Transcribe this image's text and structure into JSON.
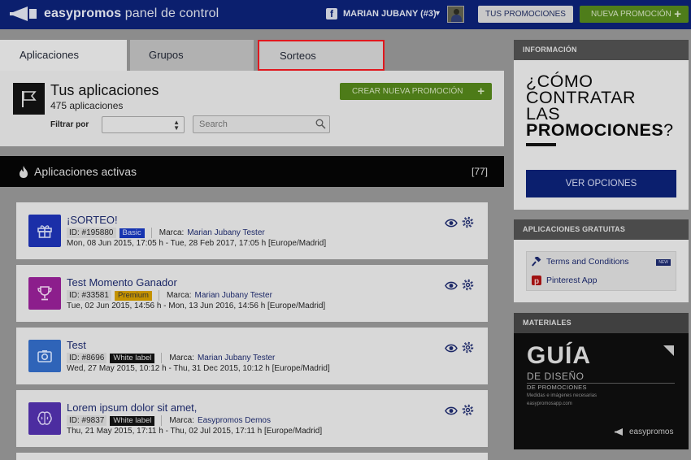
{
  "topbar": {
    "logo_brand": "easypromos",
    "logo_suffix": " panel de control",
    "user_name": "MARIAN JUBANY (#3)",
    "promotions_label": "TUS PROMOCIONES",
    "new_promotion_label": "NUEVA PROMOCIÓN"
  },
  "tabs": [
    {
      "label": "Aplicaciones",
      "active": true
    },
    {
      "label": "Grupos",
      "active": false
    },
    {
      "label": "Sorteos",
      "active": false,
      "highlighted": true
    }
  ],
  "apps": {
    "title": "Tus aplicaciones",
    "count": "475 aplicaciones",
    "filter_label": "Filtrar por",
    "filter_value": "",
    "search_placeholder": "Search",
    "create_label": "CREAR NUEVA PROMOCIÓN"
  },
  "active": {
    "title": "Aplicaciones activas",
    "count": "[77]"
  },
  "app_list": [
    {
      "name": "¡SORTEO!",
      "id": "ID: #195880",
      "badge": "Basic",
      "brand_label": "Marca:",
      "brand": "Marian Jubany Tester",
      "dates": "Mon, 08 Jun 2015, 17:05 h - Tue, 28 Feb 2017, 17:05 h [Europe/Madrid]",
      "icon": "gift-icon",
      "icon_color": "#1b2fa8"
    },
    {
      "name": "Test Momento Ganador",
      "id": "ID: #33581",
      "badge": "Premium",
      "brand_label": "Marca:",
      "brand": "Marian Jubany Tester",
      "dates": "Tue, 02 Jun 2015, 14:56 h - Mon, 13 Jun 2016, 14:56 h [Europe/Madrid]",
      "icon": "trophy-icon",
      "icon_color": "#8c1e8c"
    },
    {
      "name": "Test",
      "id": "ID: #8696",
      "badge": "White label",
      "brand_label": "Marca:",
      "brand": "Marian Jubany Tester",
      "dates": "Wed, 27 May 2015, 10:12 h - Thu, 31 Dec 2015, 10:12 h [Europe/Madrid]",
      "icon": "camera-icon",
      "icon_color": "#2f64b8"
    },
    {
      "name": "Lorem ipsum dolor sit amet,",
      "id": "ID: #9837",
      "badge": "White label",
      "brand_label": "Marca:",
      "brand": "Easypromos Demos",
      "dates": "Thu, 21 May 2015, 17:11 h - Thu, 02 Jul 2015, 17:11 h [Europe/Madrid]",
      "icon": "brain-icon",
      "icon_color": "#4c2da0"
    }
  ],
  "info": {
    "header": "INFORMACIÓN",
    "line1": "¿CÓMO",
    "line2": "CONTRATAR",
    "line3": "LAS",
    "line4_bold": "PROMOCIONES",
    "line4_end": "?",
    "button": "VER OPCIONES"
  },
  "free_apps": {
    "header": "APLICACIONES GRATUITAS",
    "items": [
      {
        "label": "Terms and Conditions",
        "icon": "gavel-icon",
        "badge": "NEW"
      },
      {
        "label": "Pinterest App",
        "icon": "pinterest-icon"
      }
    ]
  },
  "materials": {
    "header": "MATERIALES",
    "cover_title": "GUÍA",
    "cover_subtitle": "DE DISEÑO",
    "cover_line": "DE PROMOCIONES",
    "cover_small": "Medidas e imágenes necesarias",
    "cover_site": "easypromosapp.com",
    "cover_logo": "easypromos"
  }
}
